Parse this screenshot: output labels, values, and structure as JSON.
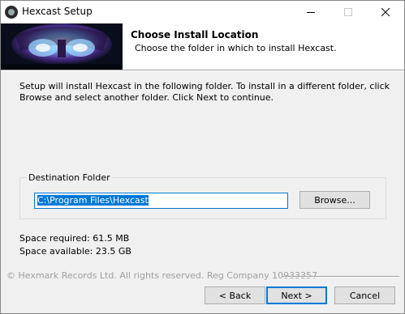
{
  "window": {
    "title": "Hexcast Setup",
    "controls": [
      "minimize",
      "maximize",
      "close"
    ]
  },
  "header": {
    "title": "Choose Install Location",
    "subtitle": "Choose the folder in which to install Hexcast."
  },
  "body": {
    "intro": "Setup will install Hexcast in the following folder. To install in a different folder, click Browse and select another folder. Click Next to continue.",
    "destination": {
      "group_label": "Destination Folder",
      "path": "C:\\Program Files\\Hexcast",
      "browse_label": "Browse..."
    },
    "space_required": "Space required: 61.5 MB",
    "space_available": "Space available: 23.5 GB"
  },
  "footer": {
    "copyright": "© Hexmark Records Ltd. All rights reserved. Reg Company 10933357",
    "back_label": "< Back",
    "next_label": "Next >",
    "cancel_label": "Cancel"
  },
  "colors": {
    "accent": "#0078d7",
    "window_bg": "#f0f0f0",
    "header_bg": "#ffffff",
    "disabled_text": "#a0a0a0"
  }
}
